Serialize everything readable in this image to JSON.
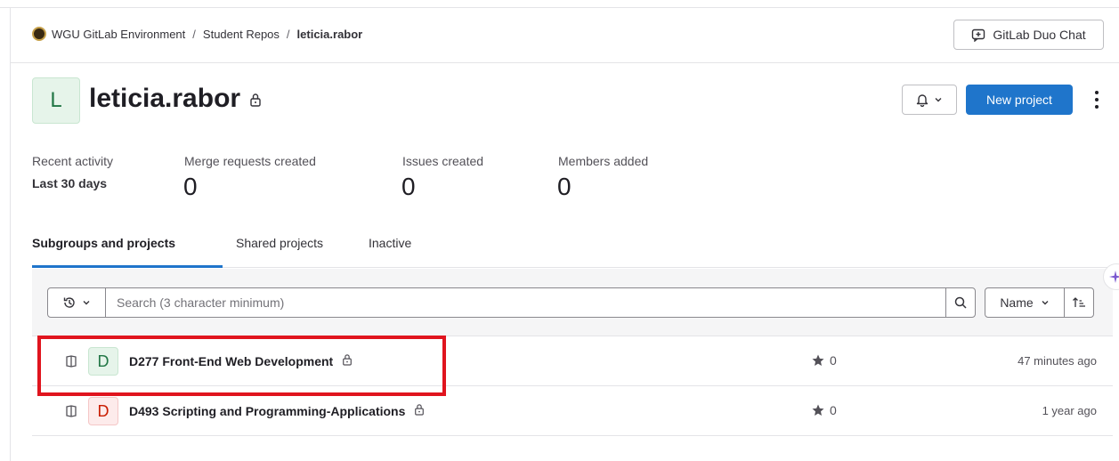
{
  "breadcrumb": {
    "items": [
      "WGU GitLab Environment",
      "Student Repos",
      "leticia.rabor"
    ],
    "separator": "/"
  },
  "duo_chat": {
    "label": "GitLab Duo Chat"
  },
  "group": {
    "avatar_letter": "L",
    "name": "leticia.rabor",
    "visibility_icon": "lock-icon"
  },
  "actions": {
    "notification_icon": "bell-icon",
    "new_project_label": "New project"
  },
  "activity": {
    "title": "Recent activity",
    "period": "Last 30 days",
    "stats": [
      {
        "label": "Merge requests created",
        "value": "0"
      },
      {
        "label": "Issues created",
        "value": "0"
      },
      {
        "label": "Members added",
        "value": "0"
      }
    ]
  },
  "tabs": [
    {
      "label": "Subgroups and projects",
      "active": true
    },
    {
      "label": "Shared projects",
      "active": false
    },
    {
      "label": "Inactive",
      "active": false
    }
  ],
  "filter": {
    "search_placeholder": "Search (3 character minimum)",
    "sort_label": "Name"
  },
  "projects": [
    {
      "avatar_letter": "D",
      "name": "D277 Front-End Web Development",
      "stars": "0",
      "updated": "47 minutes ago",
      "avatar_color": "#e6f4ea"
    },
    {
      "avatar_letter": "D",
      "name": "D493 Scripting and Programming-Applications",
      "stars": "0",
      "updated": "1 year ago",
      "avatar_color": "#fdebeb"
    }
  ],
  "colors": {
    "primary": "#1f75cb",
    "highlight": "#e0141e"
  }
}
